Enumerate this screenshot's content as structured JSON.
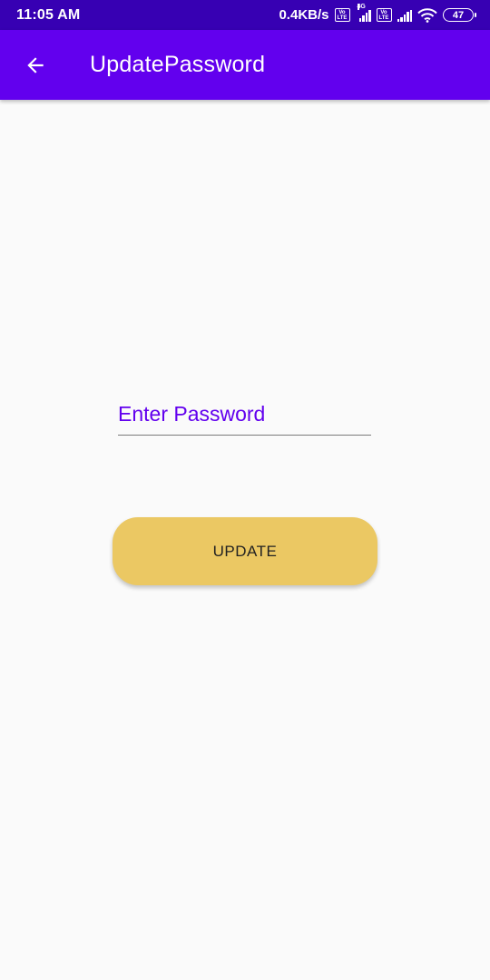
{
  "status_bar": {
    "time": "11:05 AM",
    "net_speed": "0.4KB/s",
    "volte_label_top": "Vo",
    "volte_label_bottom": "LTE",
    "network_type": "4G",
    "battery_level": "47",
    "icons": [
      "volte-icon",
      "signal-icon",
      "volte-icon",
      "signal-icon",
      "wifi-icon",
      "battery-icon"
    ]
  },
  "app_bar": {
    "title": "UpdatePassword",
    "back_icon": "arrow-back-icon",
    "color": "#6200ee"
  },
  "form": {
    "password_placeholder": "Enter Password",
    "password_value": "",
    "update_label": "UPDATE",
    "button_color": "#ebc863"
  }
}
